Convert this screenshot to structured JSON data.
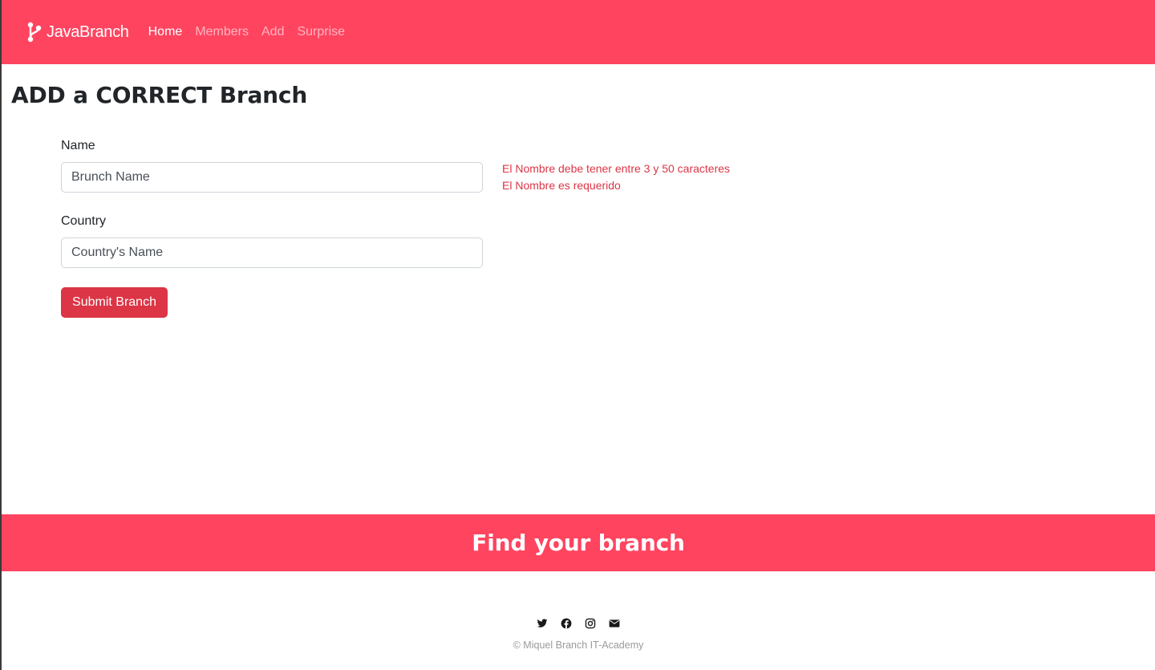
{
  "navbar": {
    "brand": "JavaBranch",
    "brand_icon": "git-branch-icon",
    "links": [
      {
        "label": "Home",
        "active": true
      },
      {
        "label": "Members",
        "active": false
      },
      {
        "label": "Add",
        "active": false
      },
      {
        "label": "Surprise",
        "active": false
      }
    ],
    "background": "#ff4460"
  },
  "page": {
    "title": "ADD a CORRECT Branch"
  },
  "form": {
    "name_label": "Name",
    "name_placeholder": "Brunch Name",
    "name_value": "",
    "name_errors": [
      "El Nombre debe tener entre 3 y 50 caracteres",
      "El Nombre es requerido"
    ],
    "country_label": "Country",
    "country_placeholder": "Country's Name",
    "country_value": "",
    "submit_label": "Submit Branch",
    "error_color": "#dc3545"
  },
  "banner": {
    "text": "Find your branch"
  },
  "footer": {
    "social_icons": [
      "twitter-icon",
      "facebook-icon",
      "instagram-icon",
      "envelope-icon"
    ],
    "copyright": "© Miquel Branch IT-Academy"
  }
}
